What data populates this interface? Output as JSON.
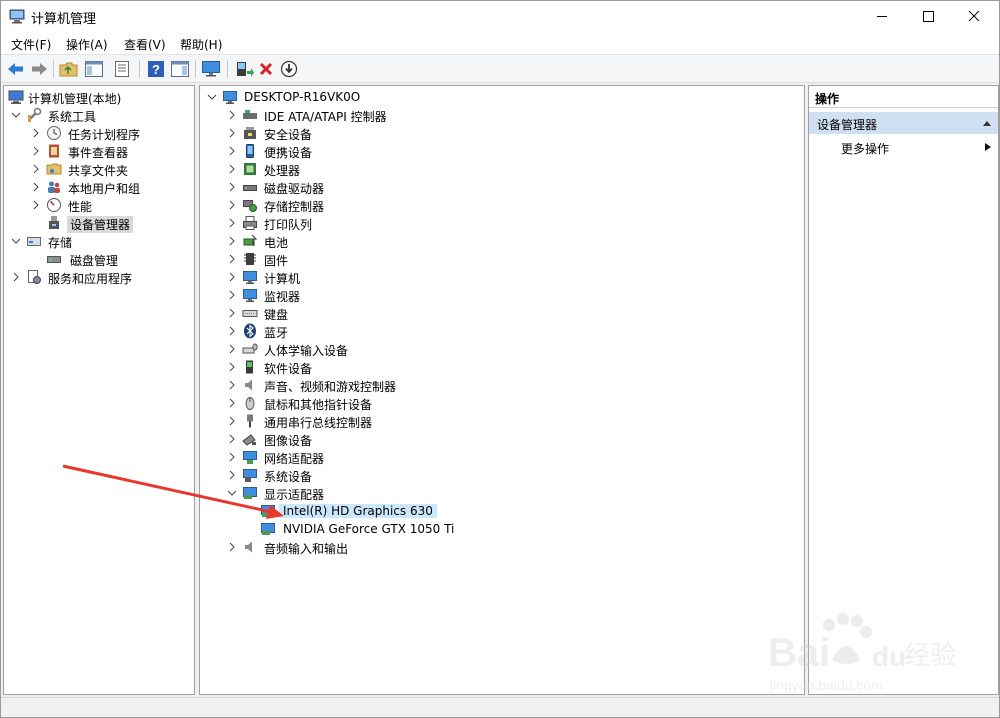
{
  "window": {
    "title": "计算机管理"
  },
  "menu": [
    "文件(F)",
    "操作(A)",
    "查看(V)",
    "帮助(H)"
  ],
  "toolbar": [
    "back-icon",
    "forward-icon",
    "up-folder-icon",
    "show-hide-tree-icon",
    "properties-icon",
    "help-icon",
    "show-action-pane-icon",
    "monitor-icon",
    "update-driver-icon",
    "uninstall-icon",
    "disable-icon"
  ],
  "left_tree": {
    "root": "计算机管理(本地)",
    "items": [
      {
        "label": "系统工具",
        "level": 1,
        "expanded": true,
        "icon": "tools-icon"
      },
      {
        "label": "任务计划程序",
        "level": 2,
        "expanded": false,
        "icon": "clock-icon"
      },
      {
        "label": "事件查看器",
        "level": 2,
        "expanded": false,
        "icon": "event-viewer-icon"
      },
      {
        "label": "共享文件夹",
        "level": 2,
        "expanded": false,
        "icon": "shared-folder-icon"
      },
      {
        "label": "本地用户和组",
        "level": 2,
        "expanded": false,
        "icon": "users-icon"
      },
      {
        "label": "性能",
        "level": 2,
        "expanded": false,
        "icon": "performance-icon"
      },
      {
        "label": "设备管理器",
        "level": 2,
        "expanded": null,
        "selected": true,
        "icon": "device-manager-icon"
      },
      {
        "label": "存储",
        "level": 1,
        "expanded": true,
        "icon": "storage-icon"
      },
      {
        "label": "磁盘管理",
        "level": 2,
        "expanded": null,
        "icon": "disk-icon"
      },
      {
        "label": "服务和应用程序",
        "level": 1,
        "expanded": false,
        "icon": "services-icon"
      }
    ]
  },
  "device_tree": {
    "computer": "DESKTOP-R16VK0O",
    "categories": [
      {
        "label": "IDE ATA/ATAPI 控制器",
        "icon": "ide-controller-icon"
      },
      {
        "label": "安全设备",
        "icon": "security-device-icon"
      },
      {
        "label": "便携设备",
        "icon": "portable-device-icon"
      },
      {
        "label": "处理器",
        "icon": "processor-icon"
      },
      {
        "label": "磁盘驱动器",
        "icon": "disk-drive-icon"
      },
      {
        "label": "存储控制器",
        "icon": "storage-controller-icon"
      },
      {
        "label": "打印队列",
        "icon": "printer-icon"
      },
      {
        "label": "电池",
        "icon": "battery-icon"
      },
      {
        "label": "固件",
        "icon": "firmware-icon"
      },
      {
        "label": "计算机",
        "icon": "computer-icon"
      },
      {
        "label": "监视器",
        "icon": "monitor-icon"
      },
      {
        "label": "键盘",
        "icon": "keyboard-icon"
      },
      {
        "label": "蓝牙",
        "icon": "bluetooth-icon"
      },
      {
        "label": "人体学输入设备",
        "icon": "hid-icon"
      },
      {
        "label": "软件设备",
        "icon": "software-device-icon"
      },
      {
        "label": "声音、视频和游戏控制器",
        "icon": "sound-icon"
      },
      {
        "label": "鼠标和其他指针设备",
        "icon": "mouse-icon"
      },
      {
        "label": "通用串行总线控制器",
        "icon": "usb-icon"
      },
      {
        "label": "图像设备",
        "icon": "camera-icon"
      },
      {
        "label": "网络适配器",
        "icon": "network-adapter-icon"
      },
      {
        "label": "系统设备",
        "icon": "system-device-icon"
      },
      {
        "label": "显示适配器",
        "icon": "display-adapter-icon",
        "expanded": true,
        "children": [
          {
            "label": "Intel(R) HD Graphics 630",
            "selected": true
          },
          {
            "label": "NVIDIA GeForce GTX 1050 Ti"
          }
        ]
      },
      {
        "label": "音频输入和输出",
        "icon": "audio-io-icon"
      }
    ]
  },
  "actions": {
    "header": "操作",
    "section": "设备管理器",
    "more": "更多操作"
  },
  "watermark": {
    "logo_text": "Baidu 经验",
    "url": "jingyan.baidu.com"
  },
  "colors": {
    "arrow": "#e8372f",
    "selection_blue": "#cce8ff",
    "action_section": "#cfe0f3"
  }
}
